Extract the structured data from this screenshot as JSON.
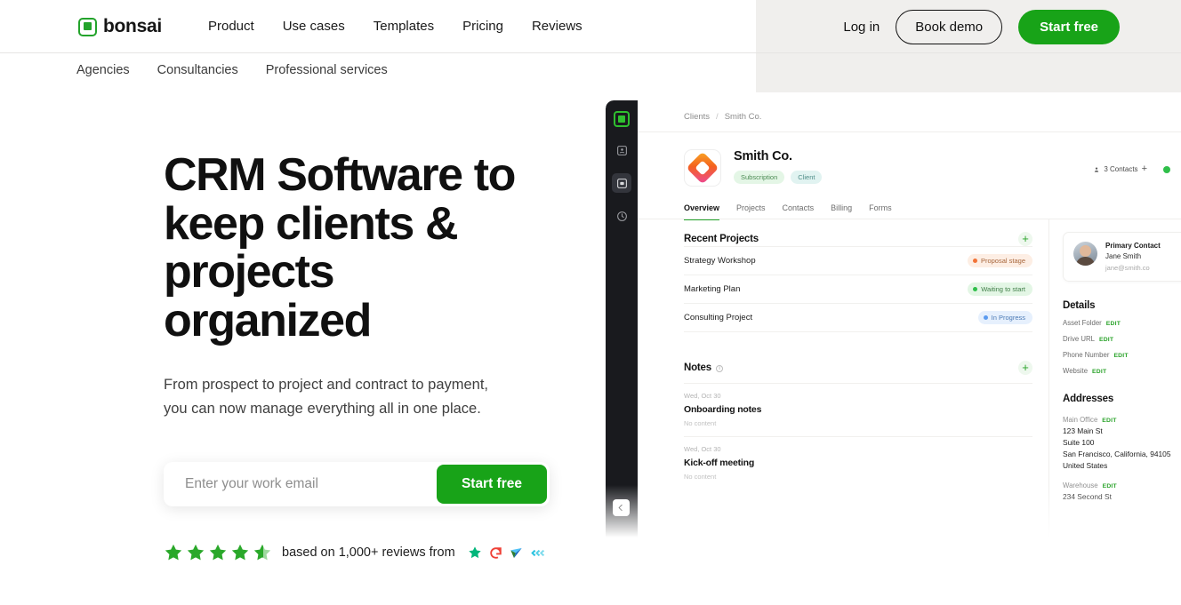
{
  "brand": {
    "name": "bonsai",
    "logo_icon": "bonsai-logo-icon",
    "accent": "#18a318"
  },
  "header": {
    "nav": [
      {
        "label": "Product"
      },
      {
        "label": "Use cases"
      },
      {
        "label": "Templates"
      },
      {
        "label": "Pricing"
      },
      {
        "label": "Reviews"
      }
    ],
    "login_label": "Log in",
    "book_demo_label": "Book demo",
    "start_free_label": "Start free"
  },
  "subnav": [
    {
      "label": "Agencies"
    },
    {
      "label": "Consultancies"
    },
    {
      "label": "Professional services"
    }
  ],
  "hero": {
    "headline": "CRM Software to keep clients & projects organized",
    "subtext": "From prospect to project and contract to payment, you can now manage everything all in one place.",
    "email_placeholder": "Enter your work email",
    "email_value": "",
    "cta_label": "Start free",
    "rating": {
      "stars": 4.5,
      "text": "based on 1,000+ reviews from",
      "platforms": [
        "trustpilot-icon",
        "g2-icon",
        "capterra-icon",
        "getapp-icon"
      ]
    }
  },
  "app": {
    "rail": {
      "logo_icon": "bonsai-app-logo-icon",
      "items": [
        {
          "icon": "contacts-icon",
          "active": false
        },
        {
          "icon": "clients-icon",
          "active": true
        },
        {
          "icon": "time-tracking-icon",
          "active": false
        }
      ],
      "collapse_icon": "collapse-sidebar-icon"
    },
    "breadcrumb": {
      "root": "Clients",
      "separator": "/",
      "current": "Smith Co."
    },
    "client": {
      "name": "Smith Co.",
      "logo_icon": "smith-co-logo-icon",
      "badges": [
        {
          "label": "Subscription"
        },
        {
          "label": "Client"
        }
      ],
      "contacts_count_label": "3 Contacts",
      "contacts_icon": "person-icon",
      "add_contact_label": "+"
    },
    "tabs": [
      {
        "label": "Overview",
        "active": true
      },
      {
        "label": "Projects",
        "active": false
      },
      {
        "label": "Contacts",
        "active": false
      },
      {
        "label": "Billing",
        "active": false
      },
      {
        "label": "Forms",
        "active": false
      }
    ],
    "recent_projects": {
      "title": "Recent Projects",
      "add_label": "+",
      "rows": [
        {
          "name": "Strategy Workshop",
          "status": "Proposal stage",
          "status_color": "orange"
        },
        {
          "name": "Marketing Plan",
          "status": "Waiting to start",
          "status_color": "green"
        },
        {
          "name": "Consulting Project",
          "status": "In Progress",
          "status_color": "blue"
        }
      ]
    },
    "notes": {
      "title": "Notes",
      "info_icon": "info-icon",
      "add_label": "+",
      "items": [
        {
          "date": "Wed, Oct 30",
          "title": "Onboarding notes",
          "body": "No content"
        },
        {
          "date": "Wed, Oct 30",
          "title": "Kick-off meeting",
          "body": "No content"
        }
      ]
    },
    "primary_contact": {
      "role": "Primary Contact",
      "name": "Jane Smith",
      "email": "jane@smith.co",
      "avatar_icon": "avatar"
    },
    "details": {
      "title": "Details",
      "edit_label": "EDIT",
      "rows": [
        {
          "label": "Asset Folder"
        },
        {
          "label": "Drive URL"
        },
        {
          "label": "Phone Number"
        },
        {
          "label": "Website"
        }
      ]
    },
    "addresses": {
      "title": "Addresses",
      "edit_label": "EDIT",
      "items": [
        {
          "label": "Main Office",
          "lines": [
            "123 Main St",
            "Suite 100",
            "San Francisco, California, 94105",
            "United States"
          ]
        },
        {
          "label": "Warehouse",
          "lines": [
            "234 Second St"
          ]
        }
      ]
    }
  }
}
